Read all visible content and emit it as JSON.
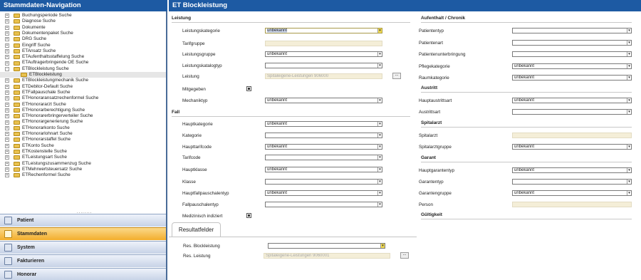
{
  "sidebar": {
    "title": "Stammdaten-Navigation",
    "tree": [
      {
        "label": "Buchungsperiode Suche",
        "exp": "+"
      },
      {
        "label": "Diagnose Suche",
        "exp": "+"
      },
      {
        "label": "Dokumente",
        "exp": "+"
      },
      {
        "label": "Dokumentenpaket Suche",
        "exp": "+"
      },
      {
        "label": "DRG Suche",
        "exp": "+"
      },
      {
        "label": "Eingriff Suche",
        "exp": "+"
      },
      {
        "label": "ETAnsatz Suche",
        "exp": "+"
      },
      {
        "label": "ETAufenthaltsstaffelung Suche",
        "exp": "+"
      },
      {
        "label": "ETAuftragerbringende OE Suche",
        "exp": "+"
      },
      {
        "label": "ETBlockleistung Suche",
        "exp": "-"
      },
      {
        "label": "ETBlockleistung",
        "exp": "",
        "child": true,
        "selected": true
      },
      {
        "label": "ETBlockleistungmechanik Suche",
        "exp": "+"
      },
      {
        "label": "ETDebitor-Default Suche",
        "exp": "+"
      },
      {
        "label": "ETFallpauschale Suche",
        "exp": "+"
      },
      {
        "label": "ETHonoraransatzrechenformel Suche",
        "exp": "+"
      },
      {
        "label": "ETHonorararzt Suche",
        "exp": "+"
      },
      {
        "label": "ETHonorarberechtigung Suche",
        "exp": "+"
      },
      {
        "label": "ETHonorarerbringerverteiler Suche",
        "exp": "+"
      },
      {
        "label": "ETHonorargenerierung Suche",
        "exp": "+"
      },
      {
        "label": "ETHonorarkonto Suche",
        "exp": "+"
      },
      {
        "label": "ETHonorarlohnart Suche",
        "exp": "+"
      },
      {
        "label": "ETHonorarstaffel Suche",
        "exp": "+"
      },
      {
        "label": "ETKonto Suche",
        "exp": "+"
      },
      {
        "label": "ETKostenstelle Suche",
        "exp": "+"
      },
      {
        "label": "ETLeistungsart Suche",
        "exp": "+"
      },
      {
        "label": "ETLeistungszusammenzug Suche",
        "exp": "+"
      },
      {
        "label": "ETMehrwertsteuersatz Suche",
        "exp": "+"
      },
      {
        "label": "ETRechenformel Suche",
        "exp": "+"
      }
    ],
    "dots": "........",
    "nav": [
      {
        "label": "Patient"
      },
      {
        "label": "Stammdaten",
        "active": true
      },
      {
        "label": "System"
      },
      {
        "label": "Fakturieren"
      },
      {
        "label": "Honorar"
      }
    ]
  },
  "main": {
    "title": "ET Blockleistung",
    "sections": {
      "leistung": "Leistung",
      "fall": "Fall",
      "aufenthalt": "Aufenthalt / Chronik",
      "austritt": "Austritt",
      "spitalarzt": "Spitalarzt",
      "garant": "Garant",
      "gueltigkeit": "Gültigkeit"
    },
    "rows": [
      {
        "label": "Leistungskategorie",
        "type": "select",
        "value": "unbekannt",
        "focus": true,
        "yellow": true
      },
      {
        "label": "Tarifgruppe",
        "type": "readonly",
        "value": ""
      },
      {
        "label": "Leistungsgruppe",
        "type": "select",
        "value": "unbekannt"
      },
      {
        "label": "Leistungskatalogtyp",
        "type": "select",
        "value": ""
      },
      {
        "label": "Leistung",
        "type": "lookup",
        "value": "Spitaleigene-Leistungen 906000",
        "button": "..."
      },
      {
        "label": "Mitgegeben",
        "type": "checkbox",
        "checked": true
      },
      {
        "label": "Mechaniktyp",
        "type": "select",
        "value": "unbekannt"
      },
      {
        "label": "Hauptkategorie",
        "type": "select",
        "value": "unbekannt"
      },
      {
        "label": "Kategorie",
        "type": "select",
        "value": ""
      },
      {
        "label": "Haupttarifcode",
        "type": "select",
        "value": "unbekannt"
      },
      {
        "label": "Tarifcode",
        "type": "select",
        "value": ""
      },
      {
        "label": "Hauptklasse",
        "type": "select",
        "value": "unbekannt"
      },
      {
        "label": "Klasse",
        "type": "select",
        "value": ""
      },
      {
        "label": "Hauptfallpauschalentyp",
        "type": "select",
        "value": "unbekannt"
      },
      {
        "label": "Fallpauschalentyp",
        "type": "select",
        "value": ""
      },
      {
        "label": "Medizinisch indiziert",
        "type": "checkbox",
        "checked": true
      },
      {
        "label": "Patiententyp",
        "type": "select",
        "value": ""
      },
      {
        "label": "Patientenart",
        "type": "select",
        "value": ""
      },
      {
        "label": "Patientenunterbringung",
        "type": "select",
        "value": ""
      },
      {
        "label": "Pflegekategorie",
        "type": "select",
        "value": "unbekannt"
      },
      {
        "label": "Raumkategorie",
        "type": "select",
        "value": "unbekannt"
      },
      {
        "label": "Hauptaustrittsart",
        "type": "select",
        "value": "unbekannt"
      },
      {
        "label": "Austrittsart",
        "type": "select",
        "value": ""
      },
      {
        "label": "Spitalarzt",
        "type": "readonly",
        "value": ""
      },
      {
        "label": "Spitalarztgruppe",
        "type": "select",
        "value": "unbekannt"
      },
      {
        "label": "Hauptgarantentyp",
        "type": "select",
        "value": "unbekannt"
      },
      {
        "label": "Garantentyp",
        "type": "select",
        "value": ""
      },
      {
        "label": "Garantengruppe",
        "type": "select",
        "value": "unbekannt"
      },
      {
        "label": "Person",
        "type": "readonly",
        "value": ""
      }
    ],
    "result": {
      "tab": "Resultatfelder",
      "rows": [
        {
          "label": "Res. Blockleistung",
          "type": "select",
          "value": "",
          "yellow": true
        },
        {
          "label": "Res. Leistung",
          "type": "lookup",
          "value": "Spitaleigene-Leistungen 9060001",
          "button": "..."
        }
      ]
    }
  }
}
